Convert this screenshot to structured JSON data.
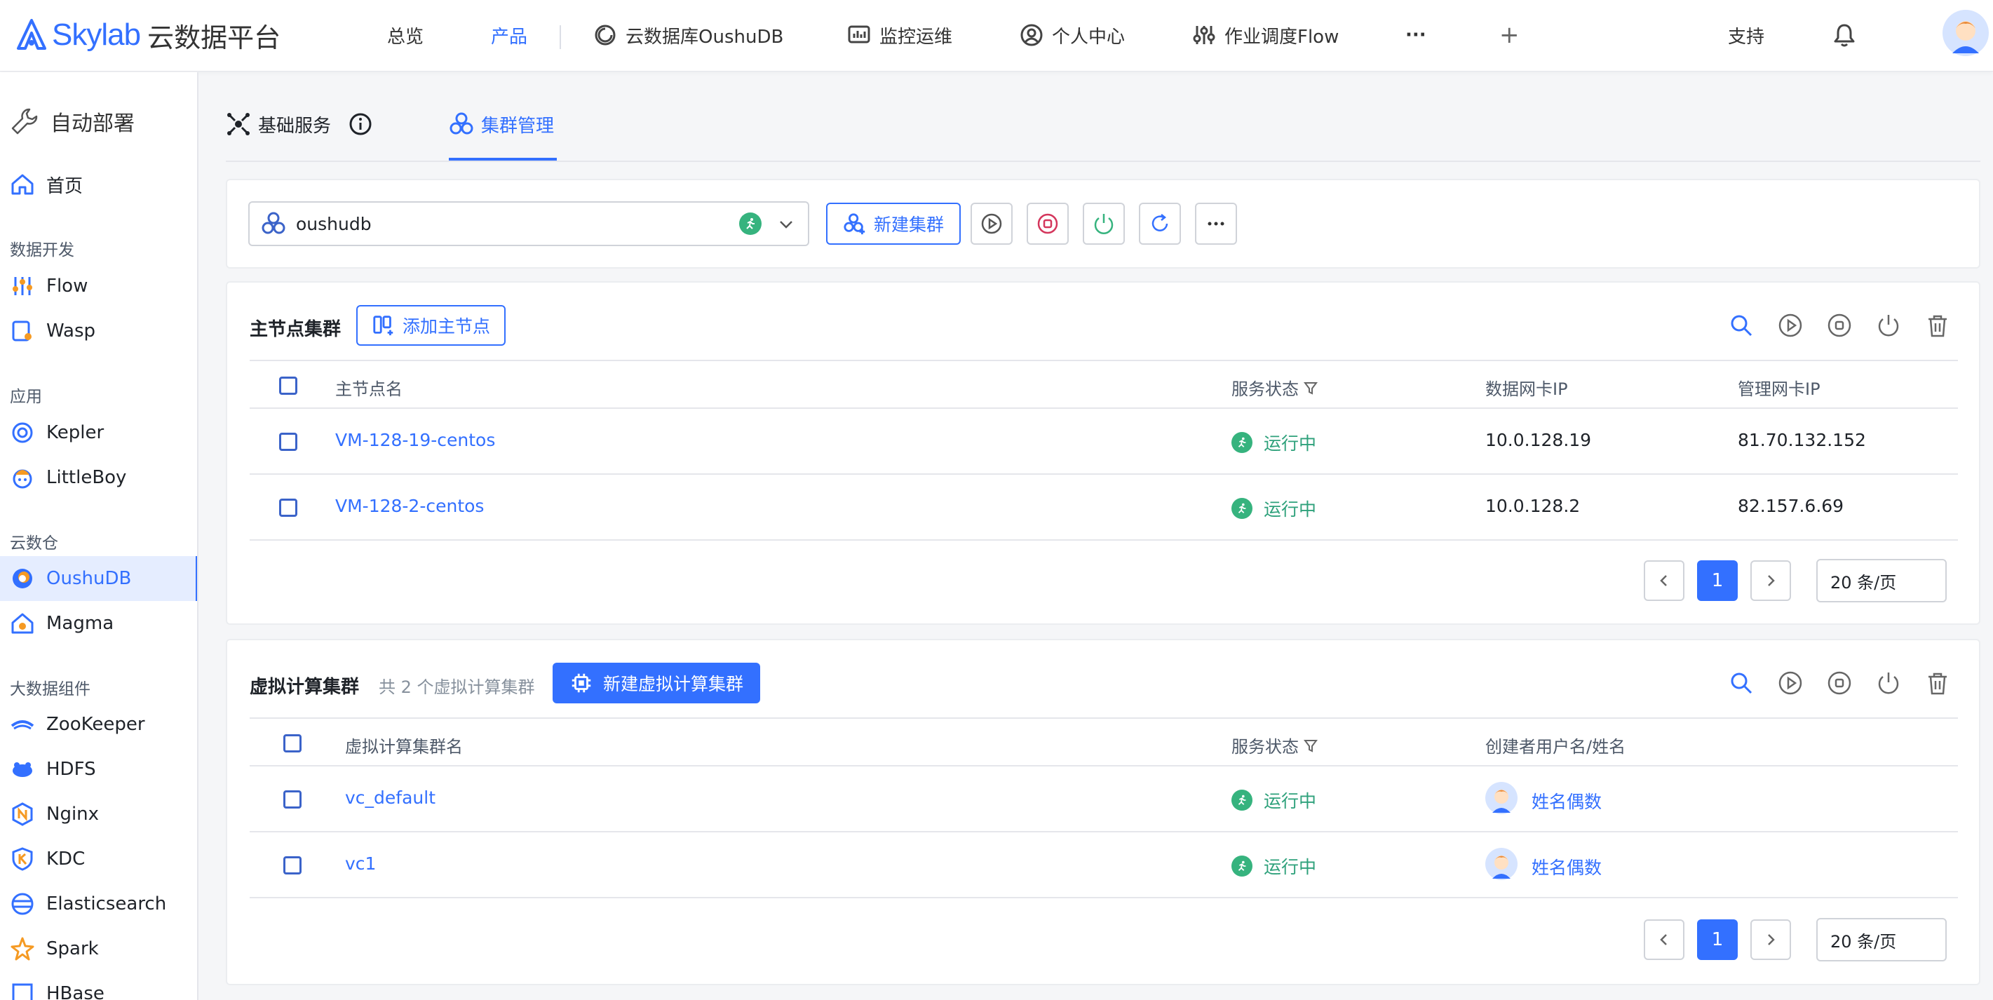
{
  "header": {
    "logo_text": "Skylab",
    "logo_sub": "云数据平台",
    "nav": [
      {
        "label": "总览"
      },
      {
        "label": "产品"
      },
      {
        "label": "云数据库OushuDB"
      },
      {
        "label": "监控运维"
      },
      {
        "label": "个人中心"
      },
      {
        "label": "作业调度Flow"
      },
      {
        "label": "···"
      },
      {
        "label": "+"
      }
    ],
    "support": "支持"
  },
  "sidebar": {
    "title": "自动部署",
    "home": "首页",
    "groups": [
      {
        "label": "数据开发",
        "items": [
          "Flow",
          "Wasp"
        ]
      },
      {
        "label": "应用",
        "items": [
          "Kepler",
          "LittleBoy"
        ]
      },
      {
        "label": "云数仓",
        "items": [
          "OushuDB",
          "Magma"
        ]
      },
      {
        "label": "大数据组件",
        "items": [
          "ZooKeeper",
          "HDFS",
          "Nginx",
          "KDC",
          "Elasticsearch",
          "Spark",
          "HBase"
        ]
      }
    ]
  },
  "tabs": [
    {
      "label": "基础服务"
    },
    {
      "label": "集群管理"
    }
  ],
  "toolbar": {
    "cluster_select": "oushudb",
    "new_cluster": "新建集群"
  },
  "master": {
    "title": "主节点集群",
    "add_button": "添加主节点",
    "columns": [
      "主节点名",
      "服务状态",
      "数据网卡IP",
      "管理网卡IP"
    ],
    "rows": [
      {
        "name": "VM-128-19-centos",
        "status": "运行中",
        "data_ip": "10.0.128.19",
        "mgmt_ip": "81.70.132.152"
      },
      {
        "name": "VM-128-2-centos",
        "status": "运行中",
        "data_ip": "10.0.128.2",
        "mgmt_ip": "82.157.6.69"
      }
    ],
    "page": "1",
    "page_size": "20 条/页"
  },
  "vc": {
    "title": "虚拟计算集群",
    "count_text": "共 2 个虚拟计算集群",
    "new_button": "新建虚拟计算集群",
    "columns": [
      "虚拟计算集群名",
      "服务状态",
      "创建者用户名/姓名"
    ],
    "rows": [
      {
        "name": "vc_default",
        "status": "运行中",
        "creator": "姓名偶数"
      },
      {
        "name": "vc1",
        "status": "运行中",
        "creator": "姓名偶数"
      }
    ],
    "page": "1",
    "page_size": "20 条/页"
  },
  "colors": {
    "accent": "#3370ff",
    "running": "#36b37e"
  }
}
